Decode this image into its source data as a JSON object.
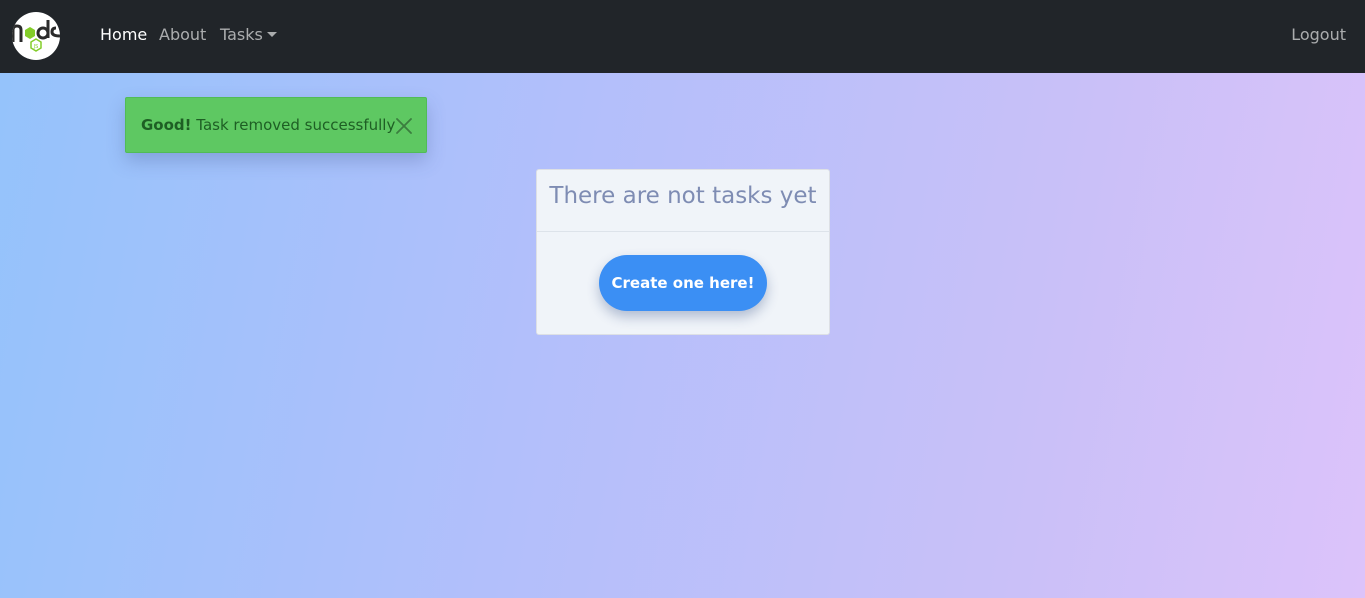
{
  "navbar": {
    "logo_text": "node",
    "home_label": "Home",
    "about_label": "About",
    "tasks_label": "Tasks",
    "logout_label": "Logout"
  },
  "alert": {
    "strong": "Good!",
    "message": " Task removed successfully",
    "color": "#5ec862"
  },
  "empty_state": {
    "title": "There are not tasks yet",
    "button_label": "Create one here!"
  },
  "colors": {
    "navbar_bg": "#212529",
    "primary_button": "#3b8ff4",
    "background_start": "#94c3fb",
    "background_end": "#dcc3fa"
  }
}
